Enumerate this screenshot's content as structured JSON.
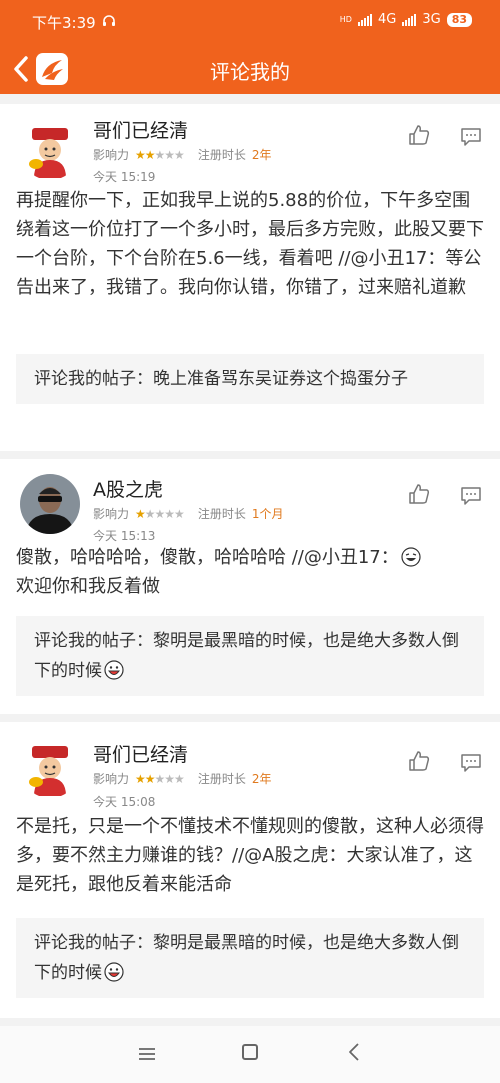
{
  "status": {
    "time": "下午3:39",
    "headset_icon": "headset-icon",
    "network1": "4G",
    "network2": "3G",
    "battery": "83"
  },
  "header": {
    "title": "评论我的",
    "back_icon": "back-chevron-icon",
    "logo_icon": "app-logo-icon"
  },
  "labels": {
    "influence": "影响力",
    "register": "注册时长",
    "quote_prefix": "评论我的帖子："
  },
  "comments": [
    {
      "user": "哥们已经清",
      "stars": 2,
      "register": "2年",
      "time": "今天 15:19",
      "text": "再提醒你一下，正如我早上说的5.88的价位，下午多空围绕着这一价位打了一个多小时，最后多方完败，此股又要下一个台阶，下个台阶在5.6一线，看着吧 //@小丑17：等公告出来了，我错了。我向你认错，你错了，过来赔礼道歉",
      "quote": "晚上准备骂东吴证券这个捣蛋分子"
    },
    {
      "user": "A股之虎",
      "stars": 1,
      "register": "1个月",
      "time": "今天 15:13",
      "text": "傻散，哈哈哈哈，傻散，哈哈哈哈 //@小丑17：",
      "text2": "欢迎你和我反着做",
      "quote": "黎明是最黑暗的时候，也是绝大多数人倒下的时候"
    },
    {
      "user": "哥们已经清",
      "stars": 2,
      "register": "2年",
      "time": "今天 15:08",
      "text": "不是托，只是一个不懂技术不懂规则的傻散，这种人必须得多，要不然主力赚谁的钱？//@A股之虎：大家认准了，这是死托，跟他反着来能活命",
      "quote": "黎明是最黑暗的时候，也是绝大多数人倒下的时候"
    }
  ],
  "colors": {
    "brand": "#f0621d",
    "register_value": "#e07a1f",
    "star": "#e6a100"
  }
}
